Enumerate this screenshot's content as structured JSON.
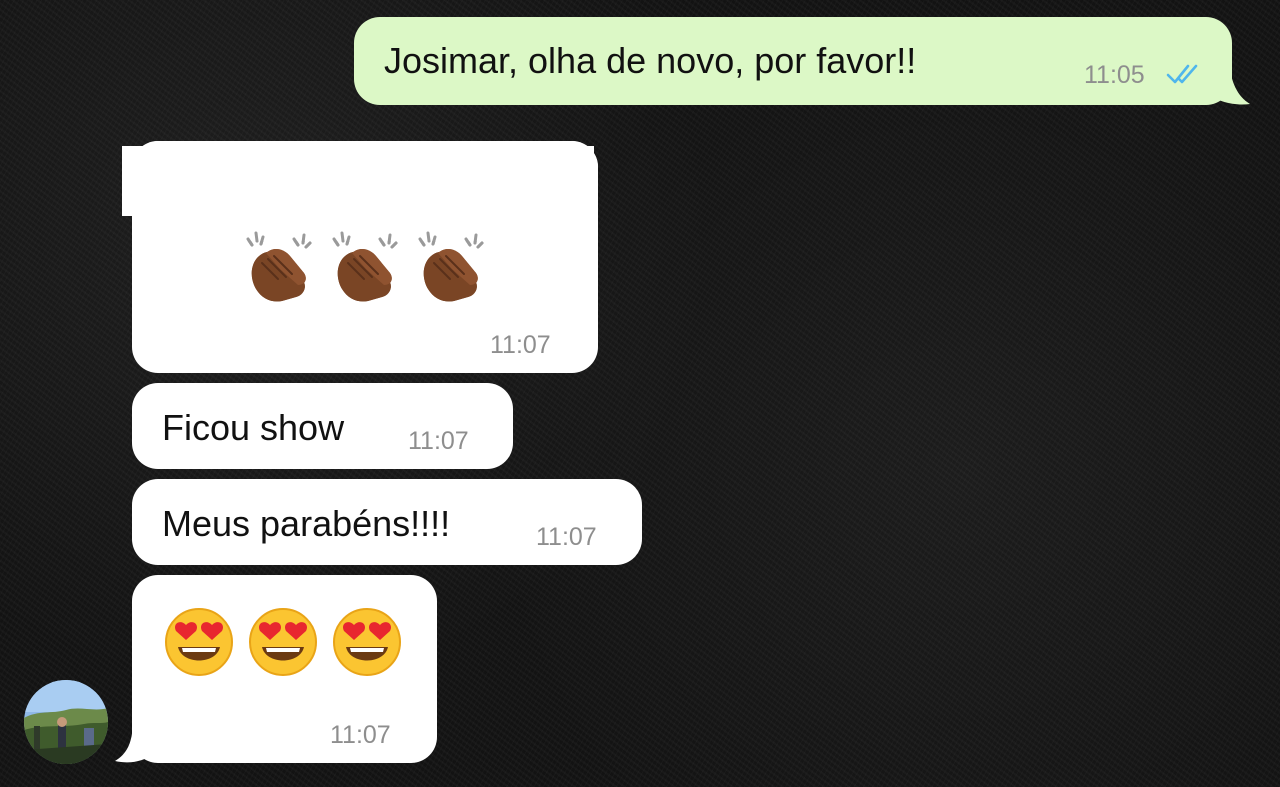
{
  "colors": {
    "outgoing_bubble": "#dcf8c6",
    "incoming_bubble": "#ffffff",
    "read_ticks": "#4fb6ec",
    "background": "#141414"
  },
  "messages": [
    {
      "direction": "outgoing",
      "text": "Josimar, olha de novo, por favor!!",
      "time": "11:05",
      "status": "read"
    },
    {
      "direction": "incoming",
      "emoji": [
        "clapping-hands-icon",
        "clapping-hands-icon",
        "clapping-hands-icon"
      ],
      "time": "11:07"
    },
    {
      "direction": "incoming",
      "text": "Ficou show",
      "time": "11:07"
    },
    {
      "direction": "incoming",
      "text": "Meus parabéns!!!!",
      "time": "11:07"
    },
    {
      "direction": "incoming",
      "emoji": [
        "heart-eyes-face-icon",
        "heart-eyes-face-icon",
        "heart-eyes-face-icon"
      ],
      "time": "11:07"
    }
  ],
  "contact": {
    "avatar_icon": "contact-avatar-photo"
  }
}
